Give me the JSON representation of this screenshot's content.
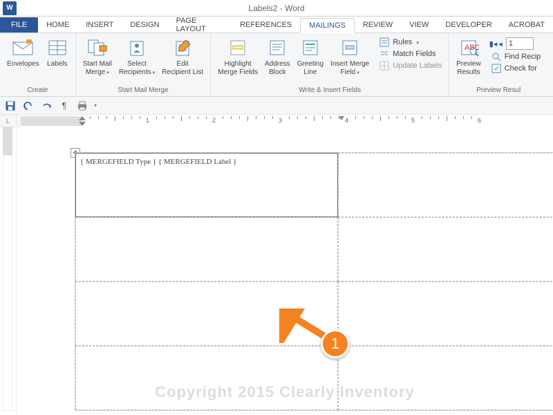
{
  "window": {
    "title": "Labels2 - Word",
    "logo": "W"
  },
  "tabs": {
    "file": "FILE",
    "items": [
      "HOME",
      "INSERT",
      "DESIGN",
      "PAGE LAYOUT",
      "REFERENCES",
      "MAILINGS",
      "REVIEW",
      "VIEW",
      "DEVELOPER",
      "ACROBAT"
    ],
    "active": "MAILINGS"
  },
  "ribbon": {
    "groups": {
      "create": {
        "label": "Create",
        "envelopes": "Envelopes",
        "labels": "Labels"
      },
      "start": {
        "label": "Start Mail Merge",
        "start_mm": "Start Mail\nMerge",
        "select_recip": "Select\nRecipients",
        "edit_recip": "Edit\nRecipient List"
      },
      "write": {
        "label": "Write & Insert Fields",
        "highlight": "Highlight\nMerge Fields",
        "address": "Address\nBlock",
        "greeting": "Greeting\nLine",
        "insert_mf": "Insert Merge\nField",
        "rules": "Rules",
        "match": "Match Fields",
        "update": "Update Labels"
      },
      "preview": {
        "label": "Preview Resul",
        "preview_btn": "Preview\nResults",
        "record": "1",
        "find": "Find Recip",
        "check": "Check for"
      }
    }
  },
  "ruler": {
    "nums": [
      "1",
      "2",
      "3",
      "4",
      "5",
      "6"
    ]
  },
  "document": {
    "mergetext": "{ MERGEFIELD Type } { MERGEFIELD Label }",
    "callout_num": "1"
  },
  "watermark": "Copyright 2015 Clearly Inventory"
}
